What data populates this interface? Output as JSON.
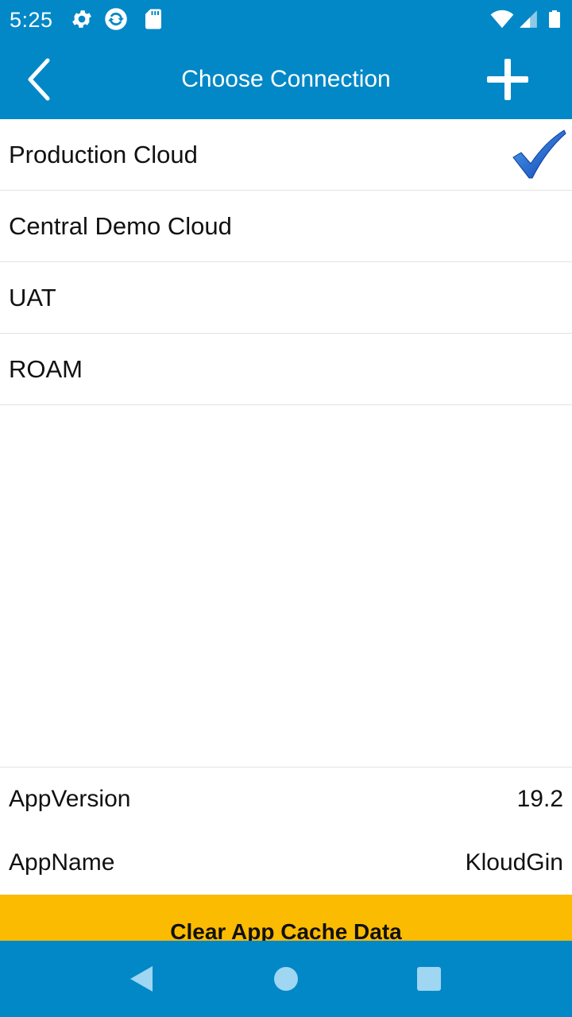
{
  "status_bar": {
    "time": "5:25",
    "icons_left": [
      "gear-icon",
      "sync-icon",
      "sd-card-icon"
    ],
    "icons_right": [
      "wifi-icon",
      "signal-icon",
      "battery-icon"
    ]
  },
  "app_bar": {
    "title": "Choose Connection",
    "back_icon": "chevron-left-icon",
    "add_icon": "plus-icon"
  },
  "connections": [
    {
      "label": "Production Cloud",
      "selected": true
    },
    {
      "label": "Central Demo Cloud",
      "selected": false
    },
    {
      "label": "UAT",
      "selected": false
    },
    {
      "label": "ROAM",
      "selected": false
    }
  ],
  "info": {
    "app_version_label": "AppVersion",
    "app_version_value": "19.2",
    "app_name_label": "AppName",
    "app_name_value": "KloudGin"
  },
  "clear_cache_label": "Clear App Cache Data",
  "nav_bar": {
    "buttons": [
      "back-triangle-icon",
      "home-circle-icon",
      "recents-square-icon"
    ]
  },
  "colors": {
    "primary": "#0288c7",
    "accent_button": "#fbbb00",
    "check": "#1565c0"
  }
}
